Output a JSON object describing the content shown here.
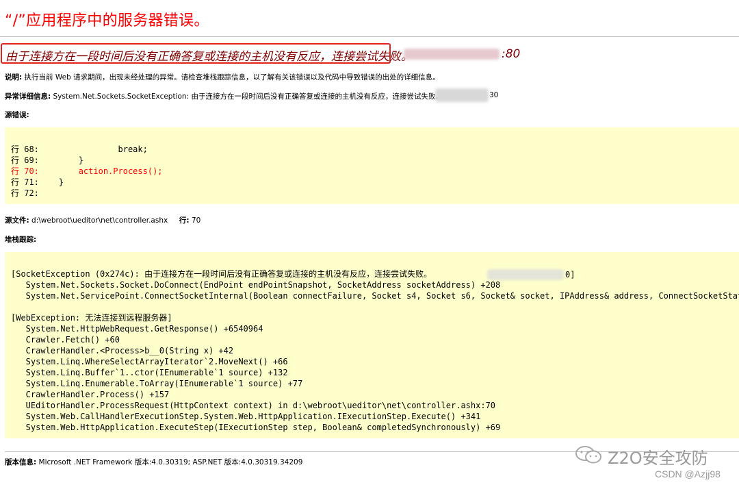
{
  "header": {
    "title": "“/”应用程序中的服务器错误。",
    "subtitle": "由于连接方在一段时间后没有正确答复或连接的主机没有反应，连接尝试失败。",
    "subtitle_tail": ":80"
  },
  "description": {
    "label": "说明:",
    "text": "执行当前 Web 请求期间，出现未经处理的异常。请检查堆栈跟踪信息，以了解有关该错误以及代码中导致错误的出处的详细信息。"
  },
  "exception_details": {
    "label": "异常详细信息:",
    "text": "System.Net.Sockets.SocketException: 由于连接方在一段时间后没有正确答复或连接的主机没有反应，连接尝试失败。",
    "tail": "30"
  },
  "source_error": {
    "label": "源错误:",
    "lines": [
      {
        "text": "行 68:                break;",
        "error": false
      },
      {
        "text": "行 69:        }",
        "error": false
      },
      {
        "text": "行 70:        action.Process();",
        "error": true
      },
      {
        "text": "行 71:    }",
        "error": false
      },
      {
        "text": "行 72:",
        "error": false
      }
    ]
  },
  "source_file": {
    "label": "源文件:",
    "path": "d:\\webroot\\ueditor\\net\\controller.ashx",
    "line_label": "行:",
    "line": "70"
  },
  "stack_trace": {
    "label": "堆栈跟踪:",
    "lines": [
      "[SocketException (0x274c): 由于连接方在一段时间后没有正确答复或连接的主机没有反应，连接尝试失败。",
      "   System.Net.Sockets.Socket.DoConnect(EndPoint endPointSnapshot, SocketAddress socketAddress) +208",
      "   System.Net.ServicePoint.ConnectSocketInternal(Boolean connectFailure, Socket s4, Socket s6, Socket& socket, IPAddress& address, ConnectSocketState",
      "",
      "[WebException: 无法连接到远程服务器]",
      "   System.Net.HttpWebRequest.GetResponse() +6540964",
      "   Crawler.Fetch() +60",
      "   CrawlerHandler.<Process>b__0(String x) +42",
      "   System.Linq.WhereSelectArrayIterator`2.MoveNext() +66",
      "   System.Linq.Buffer`1..ctor(IEnumerable`1 source) +132",
      "   System.Linq.Enumerable.ToArray(IEnumerable`1 source) +77",
      "   CrawlerHandler.Process() +157",
      "   UEditorHandler.ProcessRequest(HttpContext context) in d:\\webroot\\ueditor\\net\\controller.ashx:70",
      "   System.Web.CallHandlerExecutionStep.System.Web.HttpApplication.IExecutionStep.Execute() +341",
      "   System.Web.HttpApplication.ExecuteStep(IExecutionStep step, Boolean& completedSynchronously) +69"
    ],
    "first_line_tail": "0]"
  },
  "version": {
    "label": "版本信息:",
    "text": "Microsoft .NET Framework 版本:4.0.30319; ASP.NET 版本:4.0.30319.34209"
  },
  "watermark": {
    "brand": "Z2O安全攻防",
    "credit": "CSDN @Azjj98",
    "icon": "wechat-icon"
  },
  "colors": {
    "title": "#ff0000",
    "subtitle": "#800000",
    "code_bg": "#ffffcc",
    "highlight_border": "#e2231a",
    "error_line": "#ff0000"
  }
}
